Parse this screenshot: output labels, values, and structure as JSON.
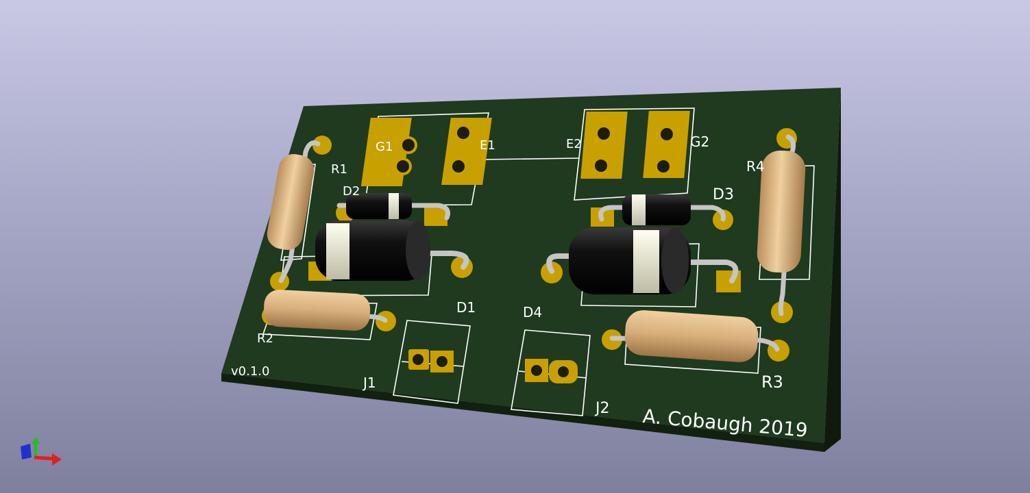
{
  "board": {
    "version": "v0.1.0",
    "author": "A. Cobaugh 2019",
    "colors": {
      "solder_mask": "#1f3a1f",
      "board_edge": "#12200f",
      "copper_pad": "#c8a000",
      "silkscreen": "#ffffff",
      "resistor_body": "#d9b07c",
      "diode_body": "#151515",
      "diode_band": "#e8e6cf",
      "lead": "#bfbfbf"
    }
  },
  "designators": {
    "r1": "R1",
    "r2": "R2",
    "r3": "R3",
    "r4": "R4",
    "d1": "D1",
    "d2": "D2",
    "d3": "D3",
    "d4": "D4",
    "j1": "J1",
    "j2": "J2",
    "g1": "G1",
    "e1": "E1",
    "e2": "E2",
    "g2": "G2"
  },
  "axes_gizmo": {
    "icon": "xyz-axes-icon"
  }
}
